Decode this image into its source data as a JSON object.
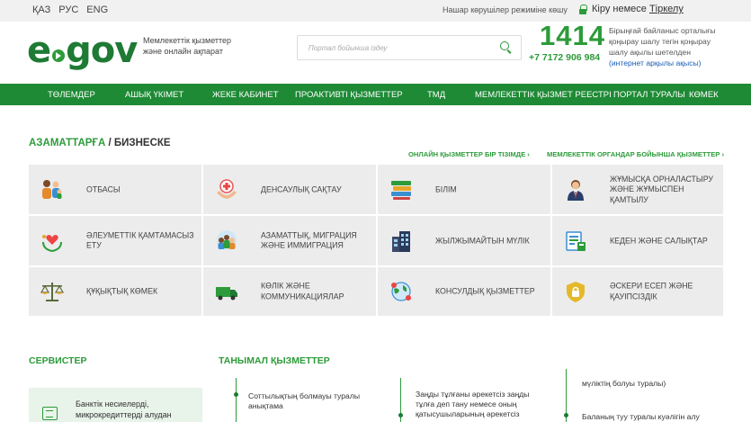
{
  "topbar": {
    "languages": [
      "ҚАЗ",
      "РУС",
      "ENG"
    ],
    "accessibility": "Нашар көрушілер режиміне көшу",
    "login_prefix": "Кіру немесе ",
    "login_link": "Тіркелу"
  },
  "header": {
    "logo_text_e": "e",
    "logo_text_gov": "gov",
    "tagline": "Мемлекеттік қызметтер және онлайн ақпарат",
    "search_placeholder": "Портал бойынша іздеу",
    "call_number": "1414",
    "phone": "+7 7172 906 984",
    "call_info": "Бірыңғай байланыс орталығы қоңырау шалу тегін қоңырау шалу ақылы шетелден ",
    "call_info_link": "(интернет арқылы ақысы)"
  },
  "nav": [
    "ТӨЛЕМДЕР",
    "АШЫҚ ҮКІМЕТ",
    "ЖЕКЕ КАБИНЕТ",
    "ПРОАКТИВТІ ҚЫЗМЕТТЕР",
    "ТМД",
    "МЕМЛЕКЕТТІК ҚЫЗМЕТ РЕЕСТРІ",
    "ПОРТАЛ ТУРАЛЫ",
    "КӨМЕК"
  ],
  "section": {
    "title_green": "АЗАМАТТАРҒА",
    "title_sep": " / ",
    "title_dark": "БИЗНЕСКЕ",
    "link_online": "ОНЛАЙН ҚЫЗМЕТТЕР БІР ТІЗІМДЕ ›",
    "link_agencies": "МЕМЛЕКЕТТІК ОРГАНДАР БОЙЫНША ҚЫЗМЕТТЕР ›"
  },
  "tiles": [
    {
      "label": "Отбасы",
      "icon": "family-icon"
    },
    {
      "label": "Денсаулық сақтау",
      "icon": "health-icon"
    },
    {
      "label": "Білім",
      "icon": "books-icon"
    },
    {
      "label": "Жұмысқа орналастыру және жұмыспен қамтылу",
      "icon": "employee-icon"
    },
    {
      "label": "Әлеуметтік қамтамасыз ету",
      "icon": "social-care-icon"
    },
    {
      "label": "Азаматтық, миграция және иммиграция",
      "icon": "citizens-icon"
    },
    {
      "label": "Жылжымайтын мүлік",
      "icon": "building-icon"
    },
    {
      "label": "Кеден және салықтар",
      "icon": "customs-icon"
    },
    {
      "label": "Құқықтық көмек",
      "icon": "scales-icon"
    },
    {
      "label": "Көлік және коммуникациялар",
      "icon": "truck-icon"
    },
    {
      "label": "Консулдық қызметтер",
      "icon": "globe-pin-icon"
    },
    {
      "label": "Әскери есеп және қауіпсіздік",
      "icon": "shield-lock-icon"
    }
  ],
  "services": {
    "title": "СЕРВИСТЕР",
    "card_text": "Банктік несиелерді, микрокредиттерді алудан"
  },
  "popular": {
    "title": "ТАНЫМАЛ ҚЫЗМЕТТЕР",
    "items": [
      "Соттылықтың болмауы туралы анықтама",
      "Заңды тұлғаны әрекетсіз заңды тұлға деп тану немесе оның қатысушыларының әрекетсіз",
      "мүліктің болуы туралы)",
      "Баланың туу туралы куәлігін алу"
    ]
  },
  "colors": {
    "brand_green": "#1e8a35",
    "accent_green": "#2d9b3a",
    "tile_bg": "#ececec",
    "link_blue": "#1a5fb4"
  }
}
